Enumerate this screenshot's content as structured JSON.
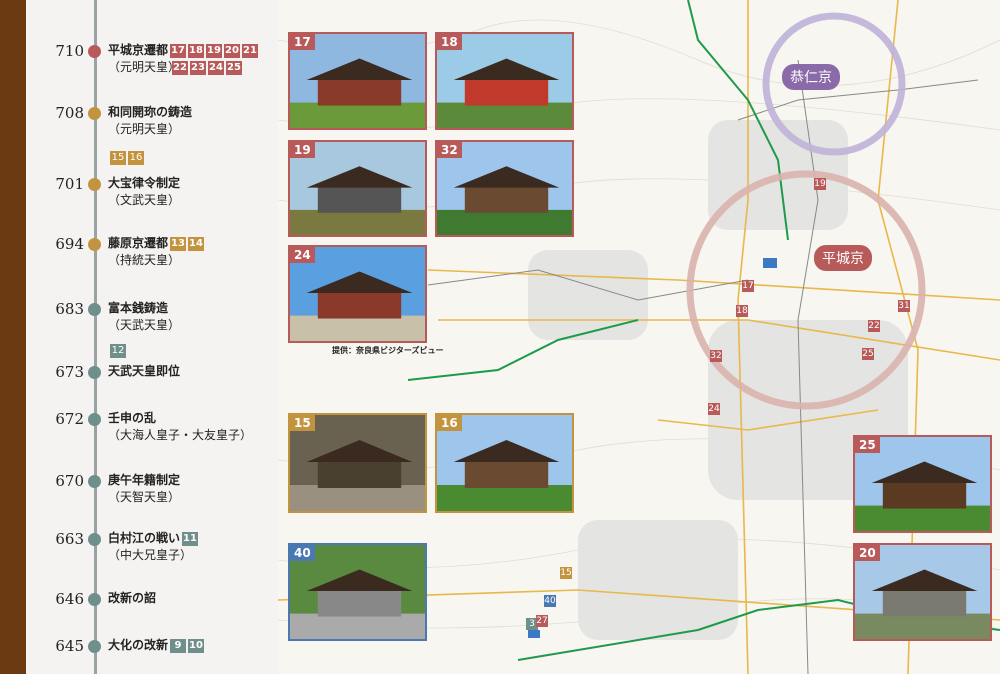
{
  "timeline": [
    {
      "year": "710",
      "title": "平城京遷都",
      "sub": "（元明天皇）",
      "dot": "#b85a5a",
      "badges": [
        "17",
        "18",
        "19",
        "20",
        "21"
      ],
      "badges2": [
        "22",
        "23",
        "24",
        "25"
      ],
      "badgeColor": "red"
    },
    {
      "year": "708",
      "title": "和同開珎の鋳造",
      "sub": "（元明天皇）",
      "dot": "#c39440",
      "badges": [],
      "badges2": []
    },
    {
      "year": "701",
      "title": "大宝律令制定",
      "sub": "（文武天皇）",
      "dot": "#c39440",
      "badges": [],
      "badges2": []
    },
    {
      "year": "694",
      "title": "藤原京遷都",
      "sub": "（持統天皇）",
      "dot": "#c39440",
      "badges": [
        "13",
        "14"
      ],
      "badges2": [],
      "badgeColor": "gold"
    },
    {
      "year": "683",
      "title": "富本銭鋳造",
      "sub": "（天武天皇）",
      "dot": "#6f8f8c",
      "badges": [],
      "badges2": []
    },
    {
      "year": "673",
      "title": "天武天皇即位",
      "sub": "",
      "dot": "#6f8f8c",
      "badges": [],
      "badges2": []
    },
    {
      "year": "672",
      "title": "壬申の乱",
      "sub": "（大海人皇子・大友皇子）",
      "dot": "#6f8f8c",
      "badges": [],
      "badges2": []
    },
    {
      "year": "670",
      "title": "庚午年籍制定",
      "sub": "（天智天皇）",
      "dot": "#6f8f8c",
      "badges": [],
      "badges2": []
    },
    {
      "year": "663",
      "title": "白村江の戦い",
      "sub": "（中大兄皇子）",
      "dot": "#6f8f8c",
      "badges": [
        "11"
      ],
      "badges2": [],
      "badgeColor": "gray"
    },
    {
      "year": "646",
      "title": "改新の詔",
      "sub": "",
      "dot": "#6f8f8c",
      "badges": [],
      "badges2": []
    },
    {
      "year": "645",
      "title": "大化の改新",
      "sub": "",
      "dot": "#6f8f8c",
      "badges": [
        "9",
        "10"
      ],
      "badges2": [],
      "badgeColor": "gray"
    }
  ],
  "standalone_badges": [
    {
      "labels": [
        "15",
        "16"
      ],
      "color": "gold"
    },
    {
      "labels": [
        "12"
      ],
      "color": "gray"
    }
  ],
  "photos": [
    "17",
    "18",
    "19",
    "32",
    "24",
    "15",
    "16",
    "40",
    "25",
    "20"
  ],
  "credit": "提供：奈良県ビジターズビュー",
  "capitals": {
    "kuni": "恭仁京",
    "heijo": "平城京"
  },
  "map_numbers": [
    "19",
    "17",
    "18",
    "31",
    "22",
    "32",
    "25",
    "24",
    "15",
    "40",
    "3",
    "27"
  ]
}
